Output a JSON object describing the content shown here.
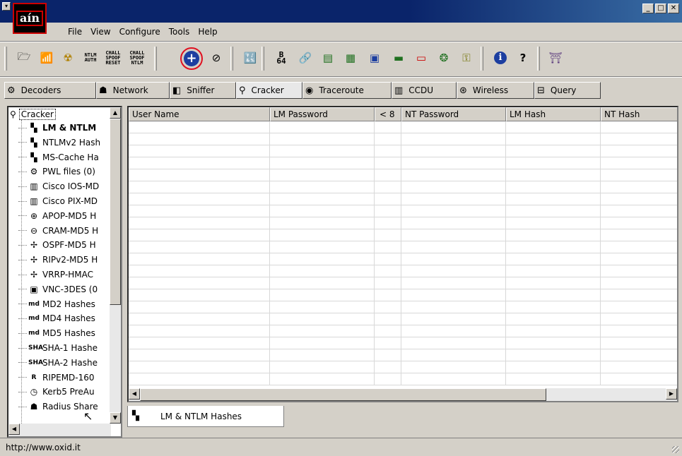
{
  "app": {
    "logo_text": "aín"
  },
  "window_controls": {
    "minimize": "_",
    "maximize": "□",
    "close": "✕"
  },
  "menu": [
    "File",
    "View",
    "Configure",
    "Tools",
    "Help"
  ],
  "toolbar": {
    "items": [
      {
        "name": "open-icon",
        "glyph": "🗁"
      },
      {
        "name": "network-card-icon",
        "glyph": "📶"
      },
      {
        "name": "radioactive-icon",
        "glyph": "☢"
      },
      {
        "name": "ntlm-auth-icon",
        "text": "NTLM\nAUTH"
      },
      {
        "name": "chall-spoof-reset-icon",
        "text": "CHALL\nSPOOF\nRESET"
      },
      {
        "name": "chall-spoof-ntlm-icon",
        "text": "CHALL\nSPOOF\nNTLM"
      },
      {
        "name": "add-icon",
        "glyph": "+"
      },
      {
        "name": "remove-icon",
        "glyph": "⊘"
      },
      {
        "name": "test-icon",
        "glyph": "🔣"
      },
      {
        "name": "base64-icon",
        "text": "B\n64"
      },
      {
        "name": "wireless-icon",
        "glyph": "🔗"
      },
      {
        "name": "hash-calc-icon",
        "glyph": "▤"
      },
      {
        "name": "vpn-icon",
        "glyph": "▦"
      },
      {
        "name": "rdp-icon",
        "glyph": "▣"
      },
      {
        "name": "terminal-icon",
        "glyph": "▬"
      },
      {
        "name": "monitor-icon",
        "glyph": "▭"
      },
      {
        "name": "globe-icon",
        "glyph": "❂"
      },
      {
        "name": "key-icon",
        "glyph": "⚿"
      },
      {
        "name": "info-icon",
        "glyph": "ℹ"
      },
      {
        "name": "help-icon",
        "glyph": "?"
      },
      {
        "name": "exit-icon",
        "glyph": "⛩"
      }
    ]
  },
  "tabs": [
    {
      "label": "Decoders",
      "icon": "⚙"
    },
    {
      "label": "Network",
      "icon": "☗"
    },
    {
      "label": "Sniffer",
      "icon": "◧"
    },
    {
      "label": "Cracker",
      "icon": "⚲"
    },
    {
      "label": "Traceroute",
      "icon": "◉"
    },
    {
      "label": "CCDU",
      "icon": "▥"
    },
    {
      "label": "Wireless",
      "icon": "⊛"
    },
    {
      "label": "Query",
      "icon": "⊟"
    }
  ],
  "tree": {
    "root": "Cracker",
    "items": [
      {
        "label": "LM & NTLM",
        "icon": "▚",
        "bold": true
      },
      {
        "label": "NTLMv2 Hash",
        "icon": "▚"
      },
      {
        "label": "MS-Cache Ha",
        "icon": "▚"
      },
      {
        "label": "PWL files (0)",
        "icon": "⚙"
      },
      {
        "label": "Cisco IOS-MD",
        "icon": "▥"
      },
      {
        "label": "Cisco PIX-MD",
        "icon": "▥"
      },
      {
        "label": "APOP-MD5 H",
        "icon": "⊕"
      },
      {
        "label": "CRAM-MD5 H",
        "icon": "⊖"
      },
      {
        "label": "OSPF-MD5 H",
        "icon": "✢"
      },
      {
        "label": "RIPv2-MD5 H",
        "icon": "✢"
      },
      {
        "label": "VRRP-HMAC",
        "icon": "✢"
      },
      {
        "label": "VNC-3DES (0",
        "icon": "▣"
      },
      {
        "label": "MD2 Hashes",
        "icon": "md"
      },
      {
        "label": "MD4 Hashes",
        "icon": "md"
      },
      {
        "label": "MD5 Hashes",
        "icon": "md"
      },
      {
        "label": "SHA-1 Hashe",
        "icon": "SHA"
      },
      {
        "label": "SHA-2 Hashe",
        "icon": "SHA"
      },
      {
        "label": "RIPEMD-160",
        "icon": "R"
      },
      {
        "label": "Kerb5 PreAu",
        "icon": "◷"
      },
      {
        "label": "Radius Share",
        "icon": "☗"
      }
    ]
  },
  "grid": {
    "columns": [
      "User Name",
      "LM Password",
      "< 8",
      "NT Password",
      "LM Hash",
      "NT Hash"
    ],
    "row_count": 22
  },
  "bottom_tab": {
    "label": "LM & NTLM Hashes",
    "icon": "▚"
  },
  "status": {
    "text": "http://www.oxid.it"
  },
  "colors": {
    "titlebar": "#0a246a",
    "highlight_circle": "#e01020",
    "add_button": "#1c3ea0"
  }
}
